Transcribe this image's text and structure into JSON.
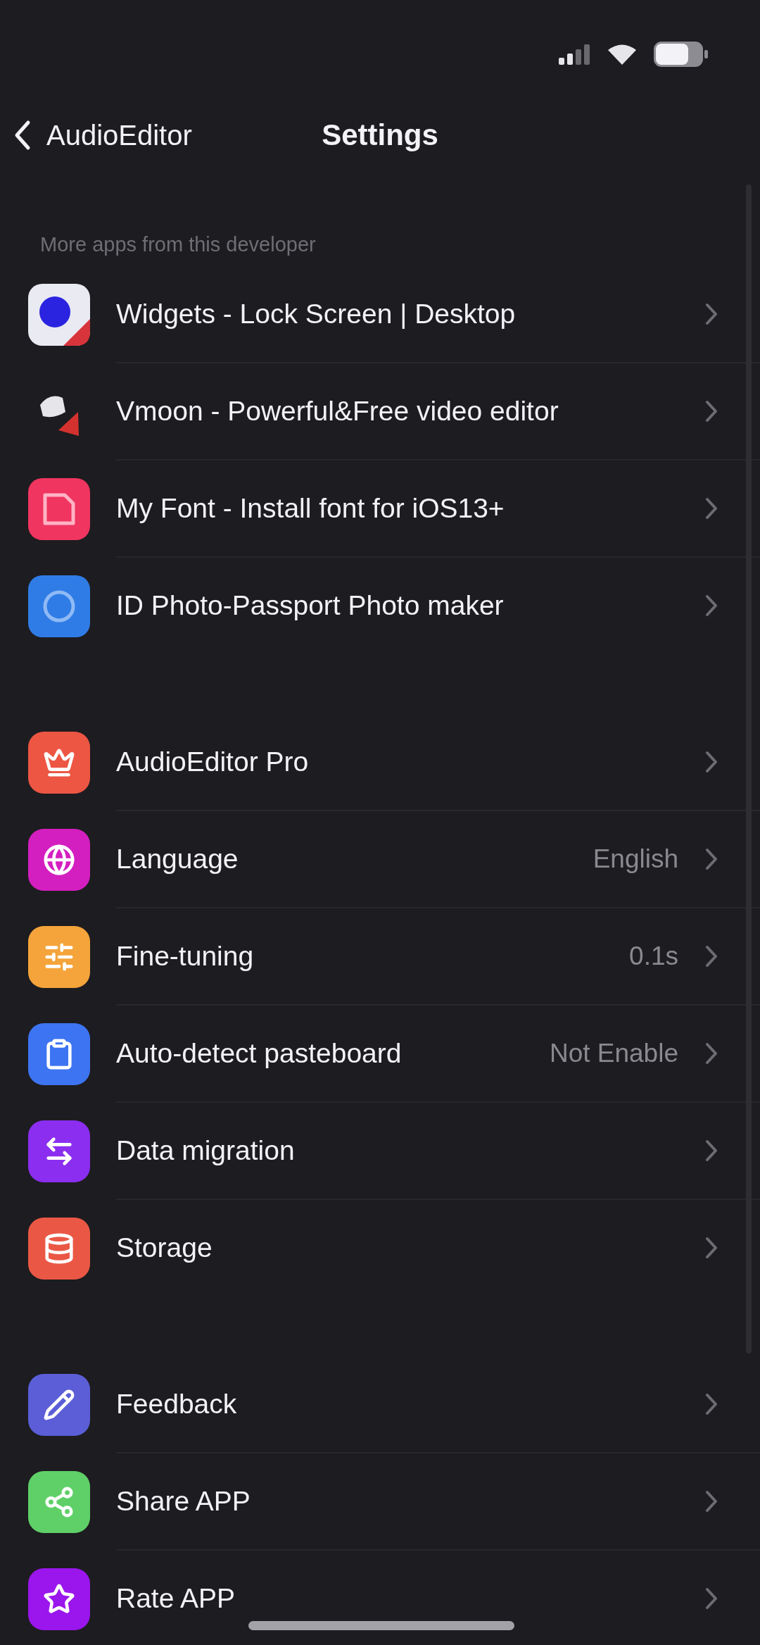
{
  "nav": {
    "back_label": "AudioEditor",
    "title": "Settings"
  },
  "sections": [
    {
      "header": "More apps from this developer",
      "items": [
        {
          "label": "Widgets - Lock Screen | Desktop"
        },
        {
          "label": "Vmoon - Powerful&Free video editor"
        },
        {
          "label": "My Font - Install font for iOS13+"
        },
        {
          "label": "ID Photo-Passport Photo maker"
        }
      ]
    },
    {
      "items": [
        {
          "label": "AudioEditor Pro",
          "color": "#ec5643"
        },
        {
          "label": "Language",
          "value": "English",
          "color": "#d41fc0"
        },
        {
          "label": "Fine-tuning",
          "value": "0.1s",
          "color": "#f4a43a"
        },
        {
          "label": "Auto-detect pasteboard",
          "value": "Not Enable",
          "color": "#3d74f2"
        },
        {
          "label": "Data migration",
          "color": "#8b2ef0"
        },
        {
          "label": "Storage",
          "color": "#ea5845"
        }
      ]
    },
    {
      "items": [
        {
          "label": "Feedback",
          "color": "#5b5ed6"
        },
        {
          "label": "Share APP",
          "color": "#5fd068"
        },
        {
          "label": "Rate APP",
          "color": "#9a16ec"
        }
      ]
    }
  ]
}
